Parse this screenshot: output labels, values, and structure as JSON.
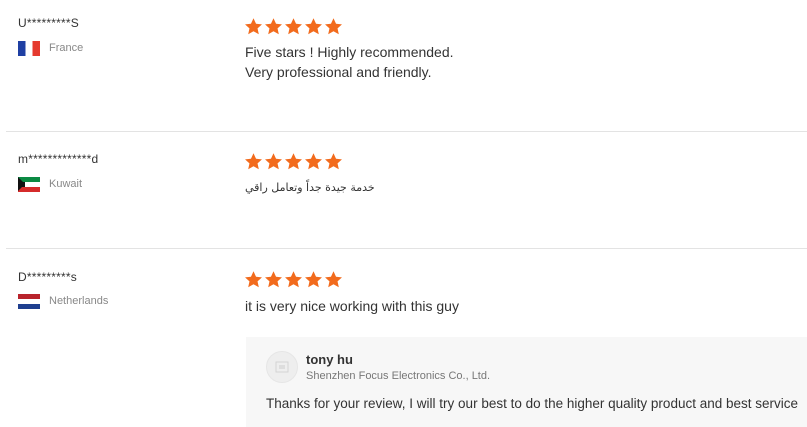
{
  "colors": {
    "star": "#f26b1d",
    "divider": "#e3e3e3",
    "reply_background": "#f7f7f7"
  },
  "reviews": [
    {
      "reviewer": "U*********S",
      "country": "France",
      "flag_icon": "france-flag-icon",
      "rating": 5,
      "text_lines": [
        "Five stars ! Highly recommended.",
        "Very professional and friendly."
      ]
    },
    {
      "reviewer": "m*************d",
      "country": "Kuwait",
      "flag_icon": "kuwait-flag-icon",
      "rating": 5,
      "text_lines": [
        "خدمة جيدة جداً وتعامل راقي"
      ]
    },
    {
      "reviewer": "D*********s",
      "country": "Netherlands",
      "flag_icon": "netherlands-flag-icon",
      "rating": 5,
      "text_lines": [
        "it is very nice working with this guy"
      ],
      "reply": {
        "author": "tony hu",
        "company": "Shenzhen Focus Electronics Co., Ltd.",
        "avatar_icon": "supplier-avatar-icon",
        "text": "Thanks for your review, I will try our best to do the higher quality product and best service"
      }
    }
  ]
}
